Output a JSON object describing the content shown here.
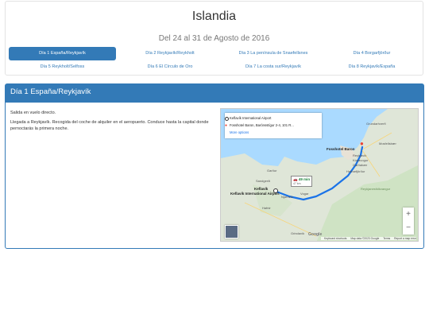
{
  "header": {
    "title": "Islandia",
    "subtitle": "Del 24 al 31 de Agosto de 2016"
  },
  "tabs": [
    {
      "label": "Día 1 España/Reykjavík",
      "active": true
    },
    {
      "label": "Día 2 Reykjavík/Reykholt",
      "active": false
    },
    {
      "label": "Día 3 La península de Snaefellsnes",
      "active": false
    },
    {
      "label": "Día 4 Borgarfjörður",
      "active": false
    },
    {
      "label": "Día 5 Reykholt/Selfoss",
      "active": false
    },
    {
      "label": "Día 6 El Círculo de Oro",
      "active": false
    },
    {
      "label": "Día 7 La costa sur/Reykjavík",
      "active": false
    },
    {
      "label": "Día 8 Reykjavík/España",
      "active": false
    }
  ],
  "day": {
    "heading": "Día 1 España/Reykjavík",
    "paragraphs": [
      "Salida en vuelo directo.",
      "Llegada a Reykjavík. Recogida del coche de alquiler en el aeropuerto. Conduce hasta la capital donde pernoctarás la primera noche."
    ]
  },
  "map": {
    "origin": "Keflavík International Airport",
    "destination": "Fosshotel Baron, Barónsstígur 2-4, 101 R...",
    "more_options": "More options",
    "eta_time": "49 min",
    "eta_distance": "47 km",
    "place_labels": {
      "dest_marker": "Fosshotel Baron",
      "origin_marker": "Keflavík International Airport",
      "grundarhverfi": "Grundarhverfi",
      "mosfellsbaer": "Mosfellsbær",
      "reykjavik": "Reykjavík",
      "kopavogur": "Kópavogur",
      "gardabaer": "Garðabær",
      "hafnarfjordur": "Hafnarfjörður",
      "gardur": "Garður",
      "sandgerdi": "Sandgerði",
      "keflavik": "Keflavík",
      "njardvik": "Njarðvík",
      "vogar": "Vogar",
      "hafnir": "Hafnir",
      "grindavik": "Grindavík",
      "reykjanesfolkvangur": "Reykjanesfólkvangur"
    },
    "zoom_in": "+",
    "zoom_out": "−",
    "google_logo": "Google",
    "attribution": {
      "shortcuts": "Keyboard shortcuts",
      "data": "Map data ©2023 Google",
      "terms": "Terms",
      "report": "Report a map error"
    },
    "colors": {
      "route": "#1a73e8",
      "water": "#aadaff",
      "land": "#dfe6d8",
      "marker": "#ea4335"
    }
  }
}
